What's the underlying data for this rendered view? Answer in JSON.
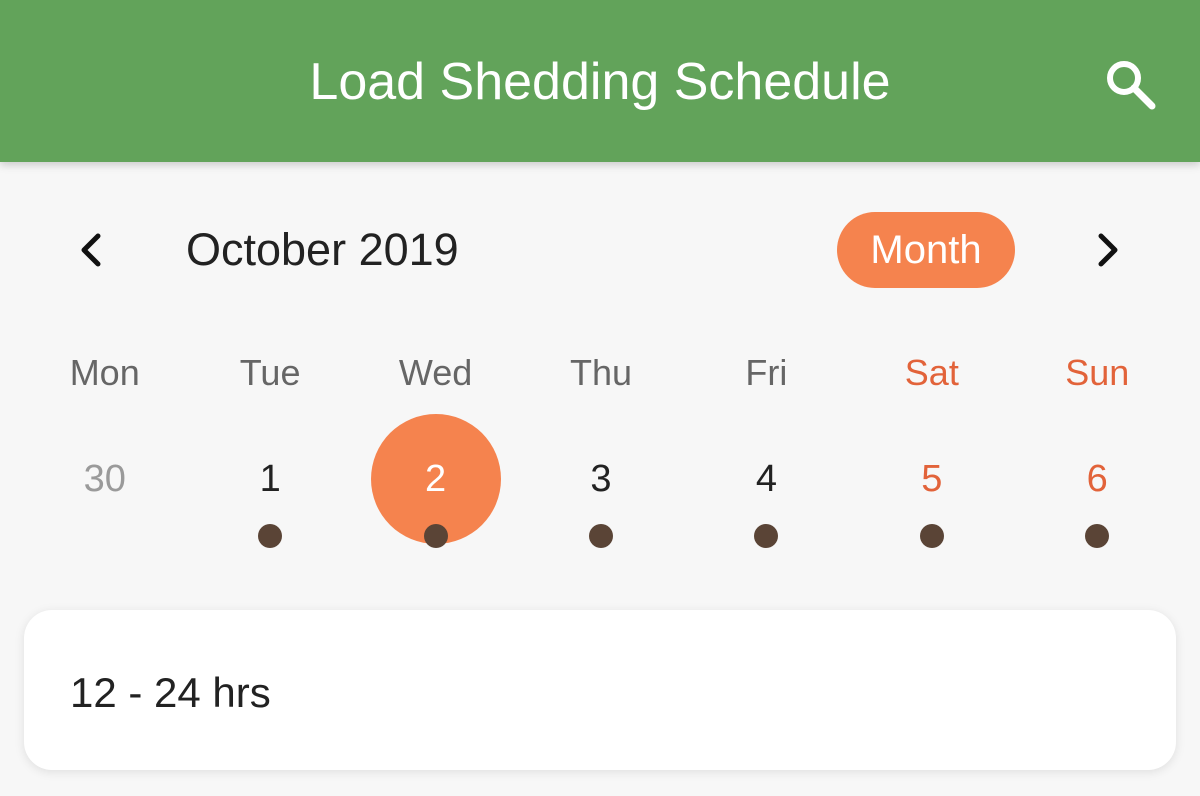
{
  "app_bar": {
    "title": "Load Shedding Schedule",
    "background_color": "#62a35a",
    "search_icon": "search-icon"
  },
  "calendar": {
    "month_title": "October 2019",
    "format_button_label": "Month",
    "accent_color": "#f5834e",
    "weekend_color": "#e2633a",
    "prev_icon": "chevron-left-icon",
    "next_icon": "chevron-right-icon",
    "weekdays": [
      "Mon",
      "Tue",
      "Wed",
      "Thu",
      "Fri",
      "Sat",
      "Sun"
    ],
    "days": [
      {
        "label": "30",
        "outside_month": true,
        "weekend": false,
        "selected": false,
        "has_event": false
      },
      {
        "label": "1",
        "outside_month": false,
        "weekend": false,
        "selected": false,
        "has_event": true
      },
      {
        "label": "2",
        "outside_month": false,
        "weekend": false,
        "selected": true,
        "has_event": true
      },
      {
        "label": "3",
        "outside_month": false,
        "weekend": false,
        "selected": false,
        "has_event": true
      },
      {
        "label": "4",
        "outside_month": false,
        "weekend": false,
        "selected": false,
        "has_event": true
      },
      {
        "label": "5",
        "outside_month": false,
        "weekend": true,
        "selected": false,
        "has_event": true
      },
      {
        "label": "6",
        "outside_month": false,
        "weekend": true,
        "selected": false,
        "has_event": true
      }
    ]
  },
  "event_list": {
    "items": [
      {
        "text": "12 - 24 hrs"
      }
    ]
  }
}
